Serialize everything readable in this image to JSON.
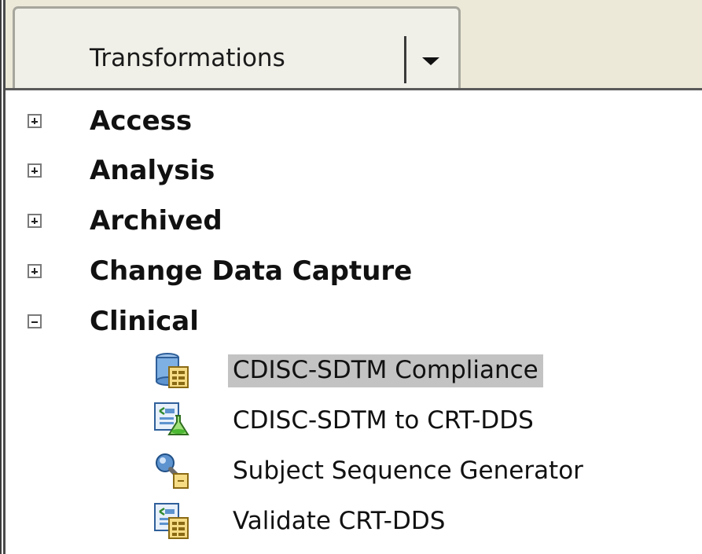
{
  "tab": {
    "label": "Transformations",
    "dropdown_icon": "chevron-down-icon"
  },
  "tree": {
    "folders": [
      {
        "label": "Access",
        "expanded": false,
        "toggle": "plus-icon"
      },
      {
        "label": "Analysis",
        "expanded": false,
        "toggle": "plus-icon"
      },
      {
        "label": "Archived",
        "expanded": false,
        "toggle": "plus-icon"
      },
      {
        "label": "Change Data Capture",
        "expanded": false,
        "toggle": "plus-icon"
      },
      {
        "label": "Clinical",
        "expanded": true,
        "toggle": "minus-icon"
      }
    ],
    "clinical_items": [
      {
        "label": "CDISC-SDTM Compliance",
        "icon": "compliance-table-icon",
        "selected": true
      },
      {
        "label": "CDISC-SDTM to CRT-DDS",
        "icon": "xml-flask-icon",
        "selected": false
      },
      {
        "label": "Subject Sequence Generator",
        "icon": "generator-key-icon",
        "selected": false
      },
      {
        "label": "Validate CRT-DDS",
        "icon": "xml-validate-icon",
        "selected": false
      }
    ]
  },
  "colors": {
    "tabstrip_bg": "#ece9d8",
    "selection_bg": "#c3c3c3"
  }
}
